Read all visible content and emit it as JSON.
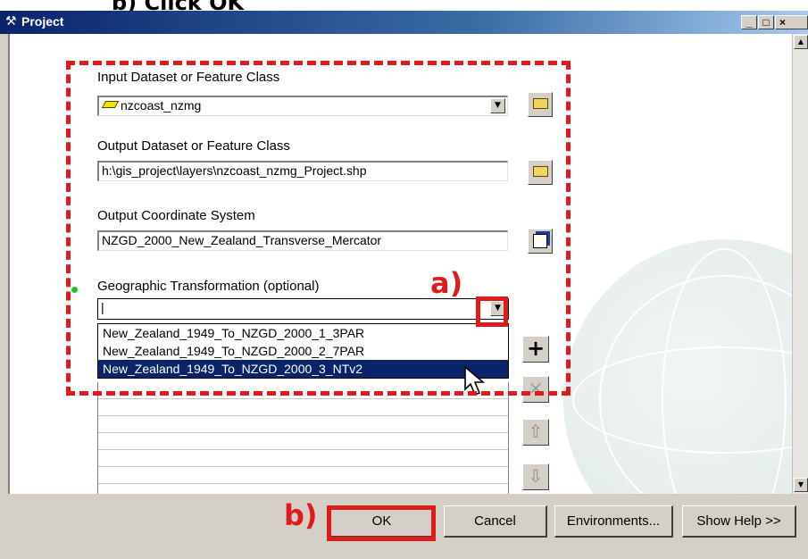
{
  "instruction_text": "b)    Click OK",
  "window": {
    "title": "Project",
    "icon": "hammer-icon",
    "minimize": "_",
    "maximize": "□",
    "close": "×"
  },
  "fields": {
    "input_label": "Input Dataset or Feature Class",
    "input_value": "nzcoast_nzmg",
    "output_label": "Output Dataset or Feature Class",
    "output_value": "h:\\gis_project\\layers\\nzcoast_nzmg_Project.shp",
    "coord_label": "Output Coordinate System",
    "coord_value": "NZGD_2000_New_Zealand_Transverse_Mercator",
    "geo_label": "Geographic Transformation (optional)",
    "geo_value": "|"
  },
  "dropdown_options": [
    "New_Zealand_1949_To_NZGD_2000_1_3PAR",
    "New_Zealand_1949_To_NZGD_2000_2_7PAR",
    "New_Zealand_1949_To_NZGD_2000_3_NTv2"
  ],
  "annotations": {
    "a": "a)",
    "b": "b)"
  },
  "buttons": {
    "ok": "OK",
    "cancel": "Cancel",
    "environments": "Environments...",
    "help": "Show Help >>"
  },
  "side_buttons": {
    "add": "+",
    "remove": "✕",
    "up": "⇧",
    "down": "⇩"
  },
  "colors": {
    "annotation": "#e01b1b",
    "titlebar": "#0a246a",
    "selection": "#0a246a"
  }
}
